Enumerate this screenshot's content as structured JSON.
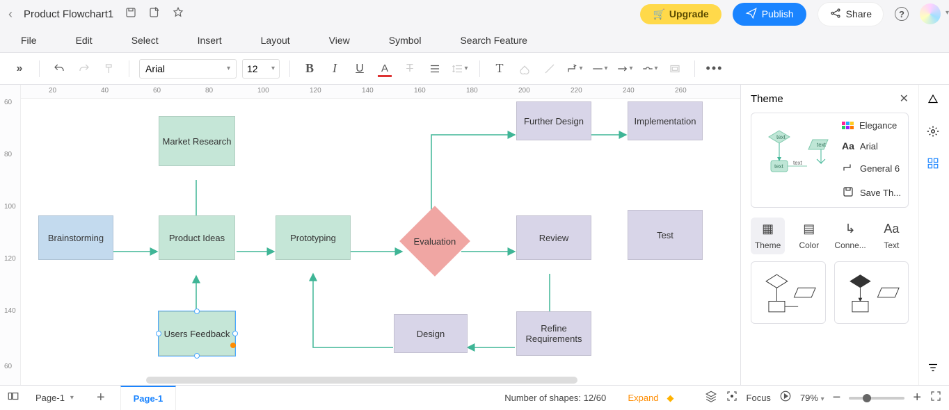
{
  "titlebar": {
    "title": "Product Flowchart1",
    "upgrade": "Upgrade",
    "publish": "Publish",
    "share": "Share"
  },
  "menubar": [
    "File",
    "Edit",
    "Select",
    "Insert",
    "Layout",
    "View",
    "Symbol",
    "Search Feature"
  ],
  "toolbar": {
    "font": "Arial",
    "size": "12"
  },
  "ruler_h": [
    "20",
    "40",
    "60",
    "80",
    "100",
    "120",
    "140",
    "160",
    "180",
    "200",
    "220",
    "240",
    "260"
  ],
  "ruler_v": [
    "60",
    "80",
    "100",
    "120",
    "140",
    "60"
  ],
  "nodes": {
    "brainstorm": "Brainstorming",
    "market": "Market Research",
    "ideas": "Product Ideas",
    "users": "Users Feedback",
    "proto": "Prototyping",
    "eval": "Evaluation",
    "further": "Further Design",
    "impl": "Implementation",
    "review": "Review",
    "test": "Test",
    "refine": "Refine Requirements",
    "design": "Design"
  },
  "theme_panel": {
    "title": "Theme",
    "elegance": "Elegance",
    "font": "Arial",
    "connector": "General 6",
    "save": "Save Th..."
  },
  "theme_tabs": [
    "Theme",
    "Color",
    "Conne...",
    "Text"
  ],
  "footer": {
    "page": "Page-1",
    "active_page": "Page-1",
    "shapes_label": "Number of shapes: ",
    "shapes_value": "12/60",
    "expand": "Expand",
    "focus": "Focus",
    "zoom": "79%"
  },
  "preview_text": "text"
}
